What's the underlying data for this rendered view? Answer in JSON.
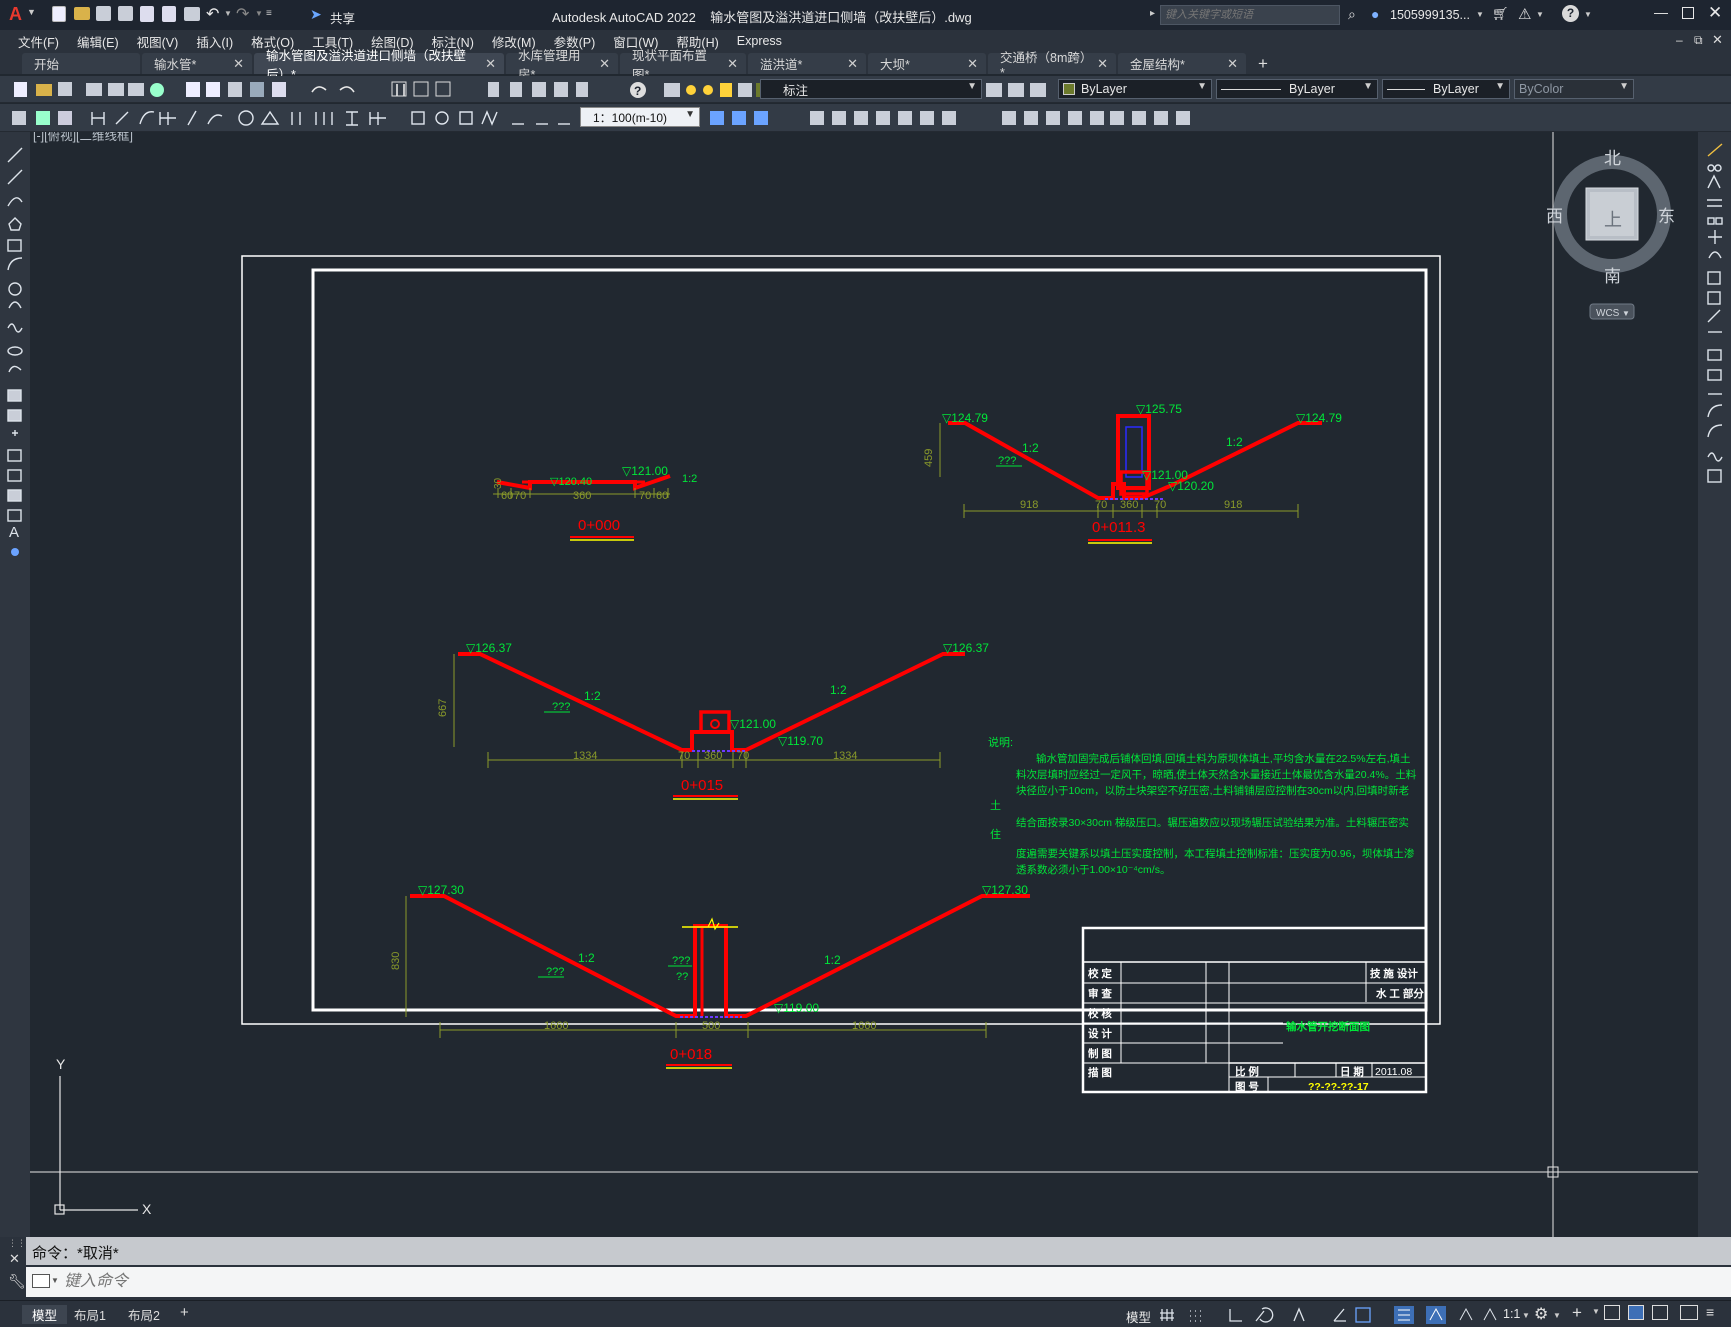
{
  "app": {
    "logo": "A",
    "title": "Autodesk AutoCAD 2022    输水管图及溢洪道进口侧墙（改扶壁后）.dwg",
    "share_label": "共享",
    "search_placeholder": "键入关键字或短语",
    "user": "1505999135...",
    "help": "?"
  },
  "menu": [
    "文件(F)",
    "编辑(E)",
    "视图(V)",
    "插入(I)",
    "格式(O)",
    "工具(T)",
    "绘图(D)",
    "标注(N)",
    "修改(M)",
    "参数(P)",
    "窗口(W)",
    "帮助(H)",
    "Express"
  ],
  "tabs": [
    {
      "label": "开始",
      "closable": false,
      "active": false
    },
    {
      "label": "输水管*",
      "closable": true,
      "active": false
    },
    {
      "label": "输水管图及溢洪道进口侧墙（改扶壁后）*",
      "closable": true,
      "active": true
    },
    {
      "label": "水库管理用房*",
      "closable": true,
      "active": false
    },
    {
      "label": "现状平面布置图*",
      "closable": true,
      "active": false
    },
    {
      "label": "溢洪道*",
      "closable": true,
      "active": false
    },
    {
      "label": "大坝*",
      "closable": true,
      "active": false
    },
    {
      "label": "交通桥（8m跨）*",
      "closable": true,
      "active": false
    },
    {
      "label": "金屋结构*",
      "closable": true,
      "active": false
    }
  ],
  "add_tab": "+",
  "props": {
    "layer": "标注",
    "color": "ByLayer",
    "linetype": "ByLayer",
    "lineweight": "ByLayer",
    "plotstyle": "ByColor",
    "scale": "1：100(m-10)"
  },
  "viewport_label": "[-][俯视][二维线框]",
  "viewcube": {
    "n": "北",
    "s": "南",
    "e": "东",
    "w": "西",
    "face": "上",
    "wcs": "WCS"
  },
  "ucs": {
    "x": "X",
    "y": "Y"
  },
  "drawing": {
    "sections": [
      {
        "label": "0+000",
        "elev_left": "▽121.00",
        "elev_mid": "▽120.40",
        "slope": "1:2",
        "dims": [
          "60",
          "70",
          "360",
          "70",
          "60"
        ],
        "height": "30"
      },
      {
        "label": "0+011.3",
        "elev_left": "▽124.79",
        "elev_right": "▽124.79",
        "elev_top": "▽125.75",
        "elev_mid": "▽121.00",
        "elev_bottom": "▽120.20",
        "slope": "1:2",
        "slope_note": "???",
        "height": "459",
        "dims": [
          "918",
          "70",
          "360",
          "70",
          "918"
        ]
      },
      {
        "label": "0+015",
        "elev_left": "▽126.37",
        "elev_right": "▽126.37",
        "elev_mid": "▽121.00",
        "elev_bottom": "▽119.70",
        "slope_left": "1:2",
        "slope_right": "1:2",
        "slope_note": "???",
        "height": "667",
        "dims": [
          "1334",
          "70",
          "360",
          "70",
          "1334"
        ]
      },
      {
        "label": "0+018",
        "elev_left": "▽127.30",
        "elev_right": "▽127.30",
        "elev_bottom": "▽119.00",
        "slope_left": "1:2",
        "slope_right": "1:2",
        "slope_note": "???",
        "slope_note2": "???",
        "slope_note3": "??",
        "height": "830",
        "dims": [
          "1660",
          "500",
          "1660"
        ]
      }
    ],
    "notes": {
      "title": "说明:",
      "side1": "土",
      "side2": "住",
      "l1": "输水管加固完成后铺体回填,回填土料为原坝体填土,平均含水量在22.5%左右,填土",
      "l2": "料次层填时应经过一定风干，晾晒,使土体天然含水量接近土体最优含水量20.4%。土料",
      "l3": "块径应小于10cm，以防土块架空不好压密,土料铺铺层应控制在30cm以内,回填时新老",
      "l4": "结合面按录30×30cm 梯级压口。辗压遍数应以现场辗压试验结果为准。土料辗压密实",
      "l5": "度遍需要关键系以填土压实度控制，本工程填土控制标准：压实度为0.96，坝体填土渗",
      "l6": "透系数必须小于1.00×10⁻⁴cm/s。"
    },
    "titleblock": {
      "rows": [
        "校 定",
        "审 查",
        "校 核",
        "设 计",
        "制 图",
        "描 图"
      ],
      "org1": "技 施  设计",
      "org2": "水 工  部分",
      "drawing_name": "输水管开挖断面图",
      "scale_label": "比 例",
      "date_label": "日 期",
      "date": "2011.08",
      "number_label": "图 号",
      "number": "??-??-??-17"
    }
  },
  "command": {
    "history": "命令：*取消*",
    "placeholder": "键入命令"
  },
  "status": {
    "layout_tabs": [
      "模型",
      "布局1",
      "布局2"
    ],
    "add": "+",
    "model": "模型",
    "scale": "1:1"
  },
  "colors": {
    "red": "#ff0000",
    "green": "#00e639",
    "yellow": "#ffff00",
    "white": "#ffffff",
    "olive": "#8a9a2a"
  }
}
